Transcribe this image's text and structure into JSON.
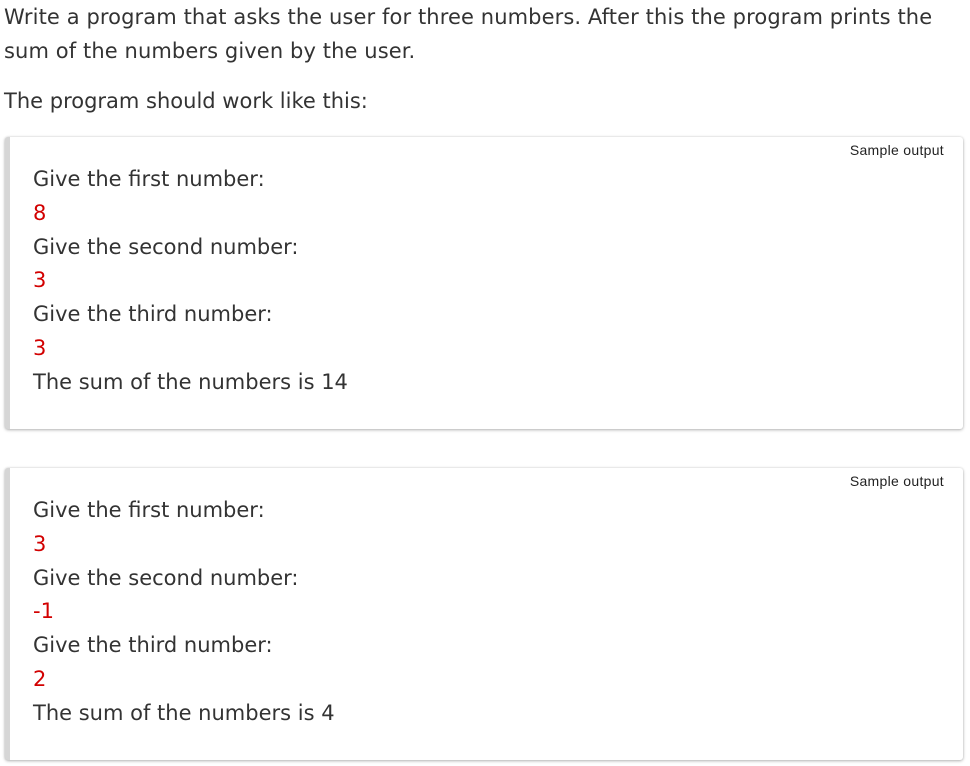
{
  "intro_text": "Write a program that asks the user for three numbers. After this the program prints the sum of the numbers given by the user.",
  "lead_text": "The program should work like this:",
  "samples": [
    {
      "label": "Sample output",
      "lines": [
        {
          "text": "Give the first number:",
          "kind": "prompt"
        },
        {
          "text": "8",
          "kind": "input"
        },
        {
          "text": "Give the second number:",
          "kind": "prompt"
        },
        {
          "text": "3",
          "kind": "input"
        },
        {
          "text": "Give the third number:",
          "kind": "prompt"
        },
        {
          "text": "3",
          "kind": "input"
        },
        {
          "text": "The sum of the numbers is 14",
          "kind": "output"
        }
      ]
    },
    {
      "label": "Sample output",
      "lines": [
        {
          "text": "Give the first number:",
          "kind": "prompt"
        },
        {
          "text": "3",
          "kind": "input"
        },
        {
          "text": "Give the second number:",
          "kind": "prompt"
        },
        {
          "text": "-1",
          "kind": "input"
        },
        {
          "text": "Give the third number:",
          "kind": "prompt"
        },
        {
          "text": "2",
          "kind": "input"
        },
        {
          "text": "The sum of the numbers is 4",
          "kind": "output"
        }
      ]
    }
  ],
  "colors": {
    "text": "#333333",
    "input": "#d20000",
    "sample_border": "#d6d6d6"
  }
}
